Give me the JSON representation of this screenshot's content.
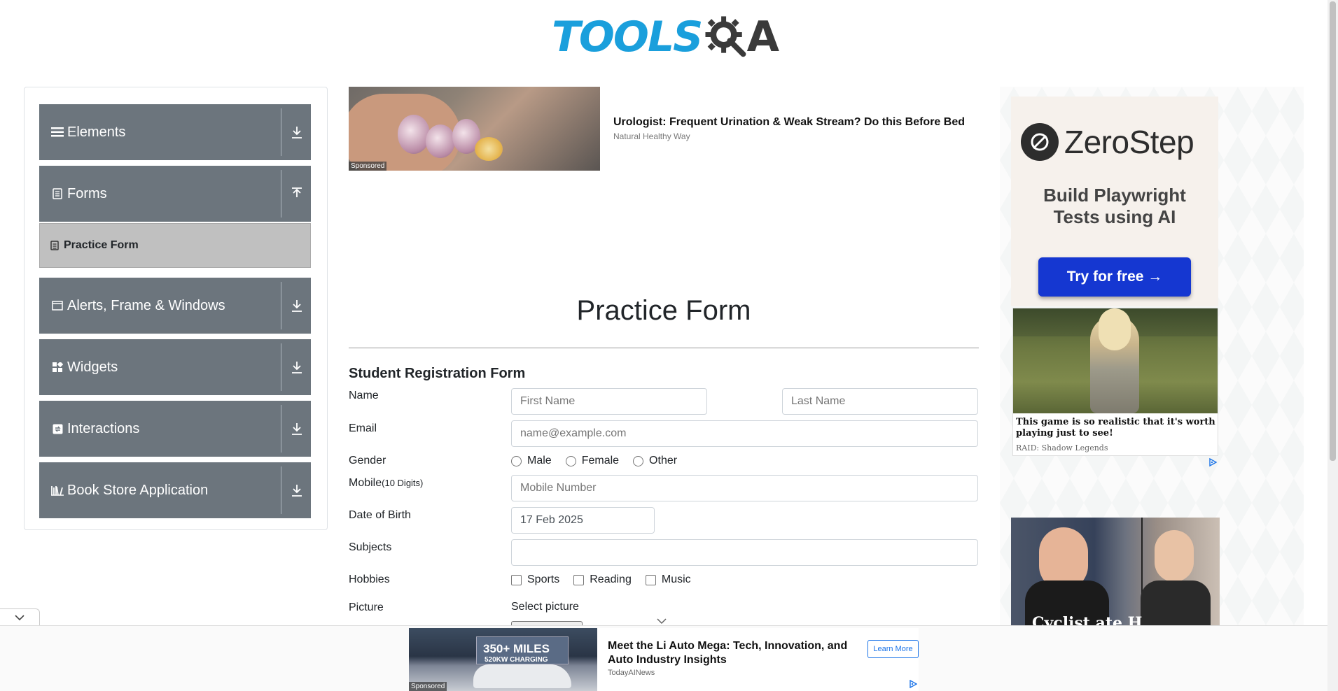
{
  "header": {
    "logo_text": "TOOLS",
    "logo_end": "A"
  },
  "sidebar": {
    "groups": [
      {
        "label": "Elements",
        "icon": "hamburger-icon",
        "arrow": "download-arrow-icon"
      },
      {
        "label": "Forms",
        "icon": "document-icon",
        "arrow": "upload-arrow-icon"
      },
      {
        "label": "Alerts, Frame & Windows",
        "icon": "window-icon",
        "arrow": "download-arrow-icon"
      },
      {
        "label": "Widgets",
        "icon": "widgets-icon",
        "arrow": "download-arrow-icon"
      },
      {
        "label": "Interactions",
        "icon": "interaction-icon",
        "arrow": "download-arrow-icon"
      },
      {
        "label": "Book Store Application",
        "icon": "library-icon",
        "arrow": "download-arrow-icon"
      }
    ],
    "active_item": {
      "label": "Practice Form",
      "icon": "form-icon"
    }
  },
  "top_ad": {
    "title": "Urologist: Frequent Urination & Weak Stream? Do this Before Bed",
    "source": "Natural Healthy Way",
    "badge": "Sponsored"
  },
  "form": {
    "page_title": "Practice Form",
    "subtitle": "Student Registration Form",
    "labels": {
      "name": "Name",
      "email": "Email",
      "gender": "Gender",
      "mobile": "Mobile",
      "mobile_hint": "(10 Digits)",
      "dob": "Date of Birth",
      "subjects": "Subjects",
      "hobbies": "Hobbies",
      "picture": "Picture"
    },
    "placeholders": {
      "first_name": "First Name",
      "last_name": "Last Name",
      "email": "name@example.com",
      "mobile": "Mobile Number"
    },
    "values": {
      "dob": "17 Feb 2025",
      "subjects": ""
    },
    "gender_options": [
      "Male",
      "Female",
      "Other"
    ],
    "hobby_options": [
      "Sports",
      "Reading",
      "Music"
    ],
    "select_picture": "Select picture"
  },
  "right_ads": {
    "zerostep": {
      "brand": "ZeroStep",
      "tagline_line1": "Build Playwright",
      "tagline_line2": "Tests using AI",
      "button": "Try for free →"
    },
    "raid": {
      "title": "This game is so realistic that it's worth playing just to see!",
      "source": "RAID: Shadow Legends"
    },
    "bottom_caption": "Cyclist ate H"
  },
  "bottom_ad": {
    "image_text_1": "350+ MILES",
    "image_text_2": "520KW CHARGING",
    "badge": "Sponsored",
    "title": "Meet the Li Auto Mega: Tech, Innovation, and Auto Industry Insights",
    "source": "TodayAINews",
    "button": "Learn More"
  },
  "colors": {
    "sidebar_group_bg": "#6c757d",
    "active_item_bg": "#c0c0c0",
    "logo_blue": "#1a9fdc",
    "zerostep_button": "#1537d1"
  }
}
